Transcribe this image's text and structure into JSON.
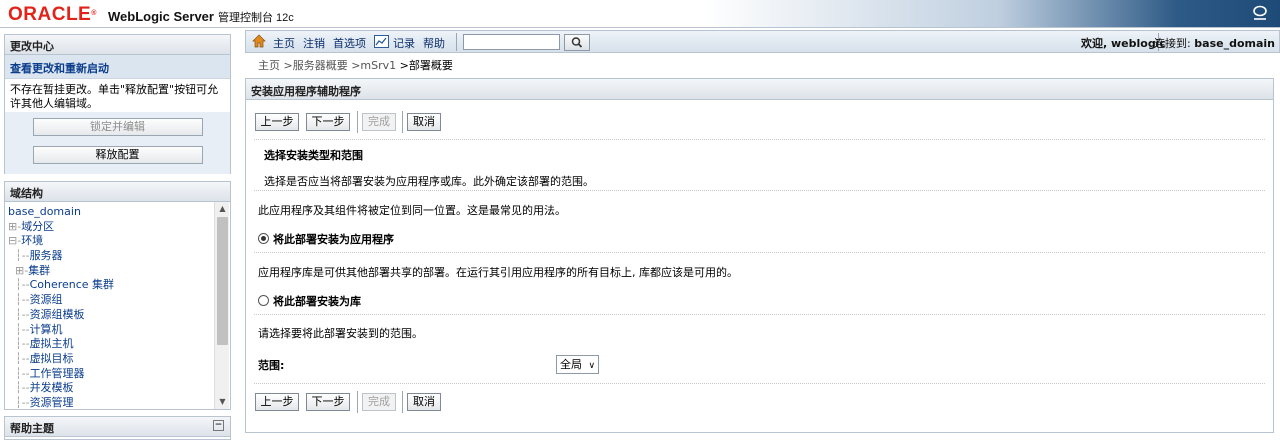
{
  "banner": {
    "logo": "ORACLE",
    "logo_mark": "®",
    "title": "WebLogic Server",
    "subtitle": "管理控制台 12c",
    "icon": "oracle-help-icon"
  },
  "change_center": {
    "header": "更改中心",
    "view_changes_link": "查看更改和重新启动",
    "description": "不存在暂挂更改。单击\"释放配置\"按钮可允许其他人编辑域。",
    "lock_button": "锁定并编辑",
    "release_button": "释放配置"
  },
  "domain_structure": {
    "header": "域结构",
    "tree": [
      {
        "label": "base_domain",
        "prefix": ""
      },
      {
        "label": "域分区",
        "prefix": "⊞-"
      },
      {
        "label": "环境",
        "prefix": "⊟-"
      },
      {
        "label": "服务器",
        "prefix": "  ┆--"
      },
      {
        "label": "集群",
        "prefix": "  ⊞-"
      },
      {
        "label": "Coherence 集群",
        "prefix": "  ┆--"
      },
      {
        "label": "资源组",
        "prefix": "  ┆--"
      },
      {
        "label": "资源组模板",
        "prefix": "  ┆--"
      },
      {
        "label": "计算机",
        "prefix": "  ┆--"
      },
      {
        "label": "虚拟主机",
        "prefix": "  ┆--"
      },
      {
        "label": "虚拟目标",
        "prefix": "  ┆--"
      },
      {
        "label": "工作管理器",
        "prefix": "  ┆--"
      },
      {
        "label": "并发模板",
        "prefix": "  ┆--"
      },
      {
        "label": "资源管理",
        "prefix": "  ┆--"
      }
    ]
  },
  "help_topics": {
    "header": "帮助主题",
    "toggle": "⊟"
  },
  "toolbar": {
    "home": "主页",
    "logout": "注销",
    "preferences": "首选项",
    "record": "记录",
    "help": "帮助",
    "search_value": "",
    "welcome": "欢迎, weblogic",
    "connected_label": "连接到:",
    "connected_domain": "base_domain"
  },
  "breadcrumb": {
    "items": [
      "主页",
      ">服务器概要",
      ">mSrv1",
      ">部署概要"
    ]
  },
  "assistant": {
    "header": "安装应用程序辅助程序",
    "buttons": {
      "back": "上一步",
      "next": "下一步",
      "finish": "完成",
      "cancel": "取消"
    },
    "section_title": "选择安装类型和范围",
    "section_desc": "选择是否应当将部署安装为应用程序或库。此外确定该部署的范围。",
    "app_desc": "此应用程序及其组件将被定位到同一位置。这是最常见的用法。",
    "radio_app_label": "将此部署安装为应用程序",
    "radio_app_selected": true,
    "lib_desc": "应用程序库是可供其他部署共享的部署。在运行其引用应用程序的所有目标上, 库都应该是可用的。",
    "radio_lib_label": "将此部署安装为库",
    "radio_lib_selected": false,
    "scope_desc": "请选择要将此部署安装到的范围。",
    "scope_label": "范围:",
    "scope_value": "全局"
  }
}
